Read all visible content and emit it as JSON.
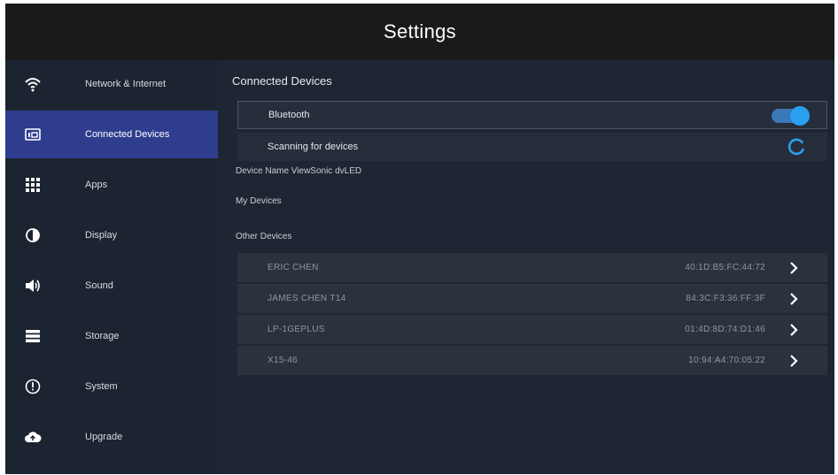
{
  "header": {
    "title": "Settings"
  },
  "sidebar": {
    "items": [
      {
        "label": "Network & Internet",
        "icon": "wifi-icon",
        "active": false
      },
      {
        "label": "Connected Devices",
        "icon": "devices-icon",
        "active": true
      },
      {
        "label": "Apps",
        "icon": "apps-grid-icon",
        "active": false
      },
      {
        "label": "Display",
        "icon": "brightness-icon",
        "active": false
      },
      {
        "label": "Sound",
        "icon": "speaker-icon",
        "active": false
      },
      {
        "label": "Storage",
        "icon": "storage-icon",
        "active": false
      },
      {
        "label": "System",
        "icon": "info-icon",
        "active": false
      },
      {
        "label": "Upgrade",
        "icon": "cloud-upload-icon",
        "active": false
      }
    ]
  },
  "main": {
    "title": "Connected Devices",
    "bluetooth": {
      "label": "Bluetooth",
      "enabled": true
    },
    "scanning": {
      "label": "Scanning for devices"
    },
    "device_name": "Device Name ViewSonic dvLED",
    "my_devices_label": "My Devices",
    "other_devices_label": "Other Devices",
    "other_devices": [
      {
        "name": "ERIC CHEN",
        "mac": "40:1D:B5:FC:44:72"
      },
      {
        "name": "JAMES CHEN T14",
        "mac": "84:3C:F3:36:FF:3F"
      },
      {
        "name": "LP-1GEPLUS",
        "mac": "01:4D:8D:74:D1:46"
      },
      {
        "name": "X15-46",
        "mac": "10:94:A4:70:05:22"
      }
    ]
  },
  "colors": {
    "accent": "#2f3d8f",
    "toggle_on": "#2aa0f0",
    "header_bg": "#1a1a1a",
    "panel_bg": "#1e2633"
  }
}
